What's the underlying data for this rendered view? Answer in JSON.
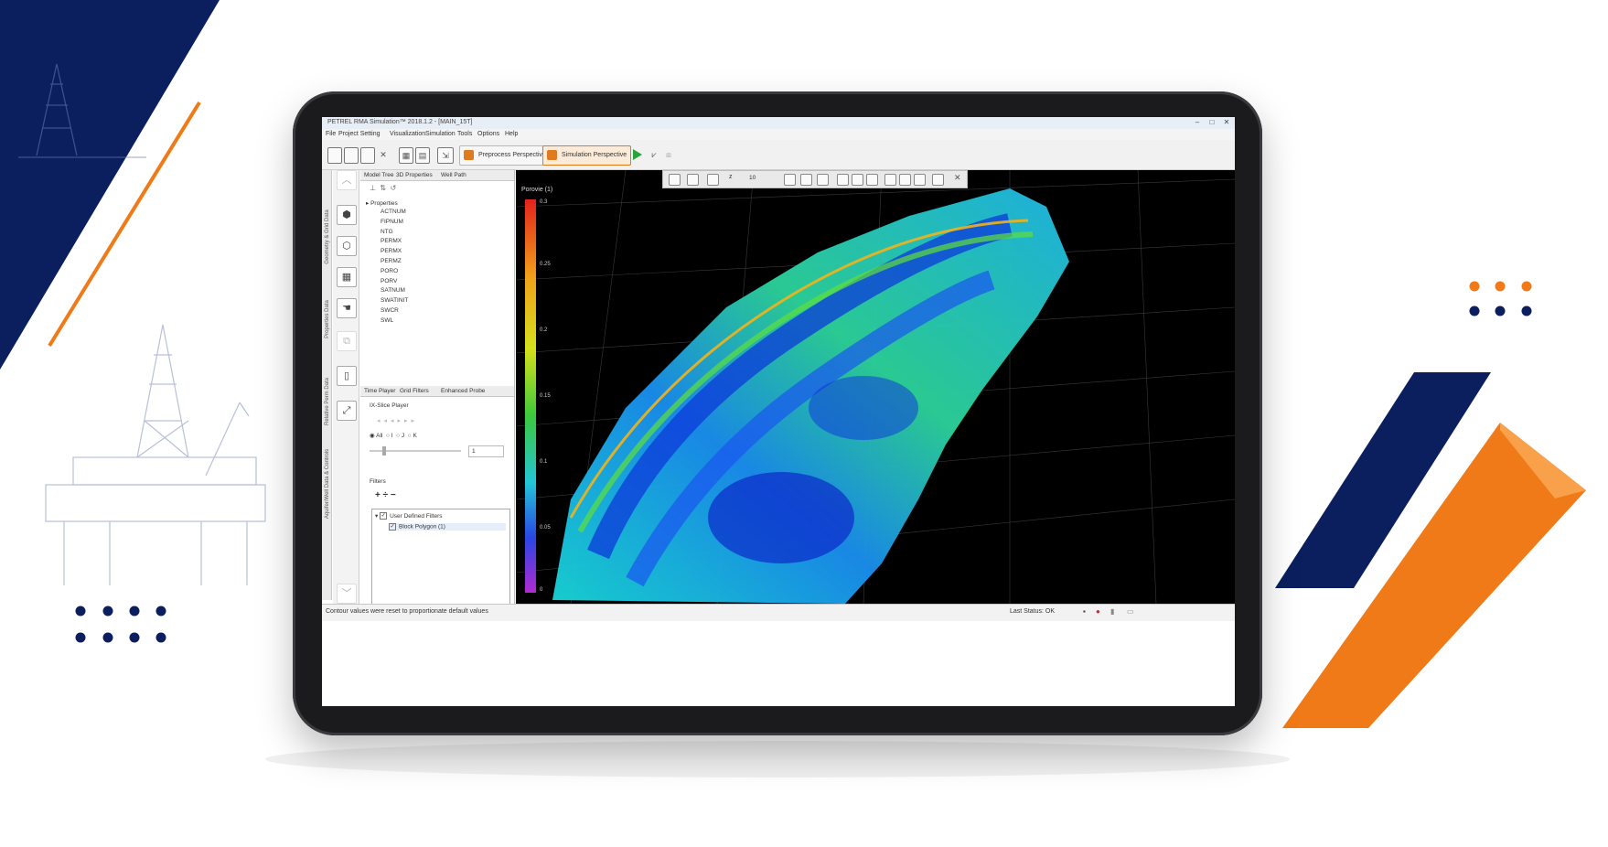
{
  "window": {
    "title": "PETREL RMA Simulation™ 2018.1.2 - [MAIN_15T]"
  },
  "menu": [
    "File",
    "Project Setting",
    "Visualization",
    "Simulation",
    "Tools",
    "Options",
    "Help"
  ],
  "toolbar": {
    "preprocess_label": "Preprocess Perspective",
    "simulation_label": "Simulation Perspective"
  },
  "left_strip": {
    "labels": [
      "Geometry & Grid Data",
      "Properties Data",
      "Relative Perm Data",
      "Aquifer/Well Data & Controls"
    ]
  },
  "top_tabs": [
    "Model Tree",
    "3D Properties",
    "Well Path"
  ],
  "tree": {
    "header": "Properties",
    "items": [
      "ACTNUM",
      "FIPNUM",
      "NTG",
      "PERMX",
      "PERMX",
      "PERMZ",
      "PORO",
      "PORV",
      "SATNUM",
      "SWATINIT",
      "SWCR",
      "SWL"
    ]
  },
  "bottom_tabs": [
    "Time Player",
    "Grid Filters",
    "Enhanced Probe"
  ],
  "slice_player": {
    "title": "IX-Slice Player",
    "radio_labels": [
      "All",
      "I",
      "J",
      "K"
    ],
    "selected": "All",
    "slider_value": "1"
  },
  "filters": {
    "title": "Filters",
    "tools": "+ ÷ −",
    "root": "User Defined Filters",
    "child": "Block Polygon (1)"
  },
  "viewport": {
    "legend_title": "Porovie (1)",
    "legend_ticks": [
      "0.3",
      "0.25",
      "0.2",
      "0.15",
      "0.1",
      "0.05",
      "0"
    ],
    "zoom_value": "10"
  },
  "status": {
    "message": "Contour values were reset to proportionate default values",
    "last_status": "Last Status: OK"
  },
  "colors": {
    "navy": "#0b1f5f",
    "orange": "#f07a17",
    "bezel": "#1b1b1d"
  }
}
